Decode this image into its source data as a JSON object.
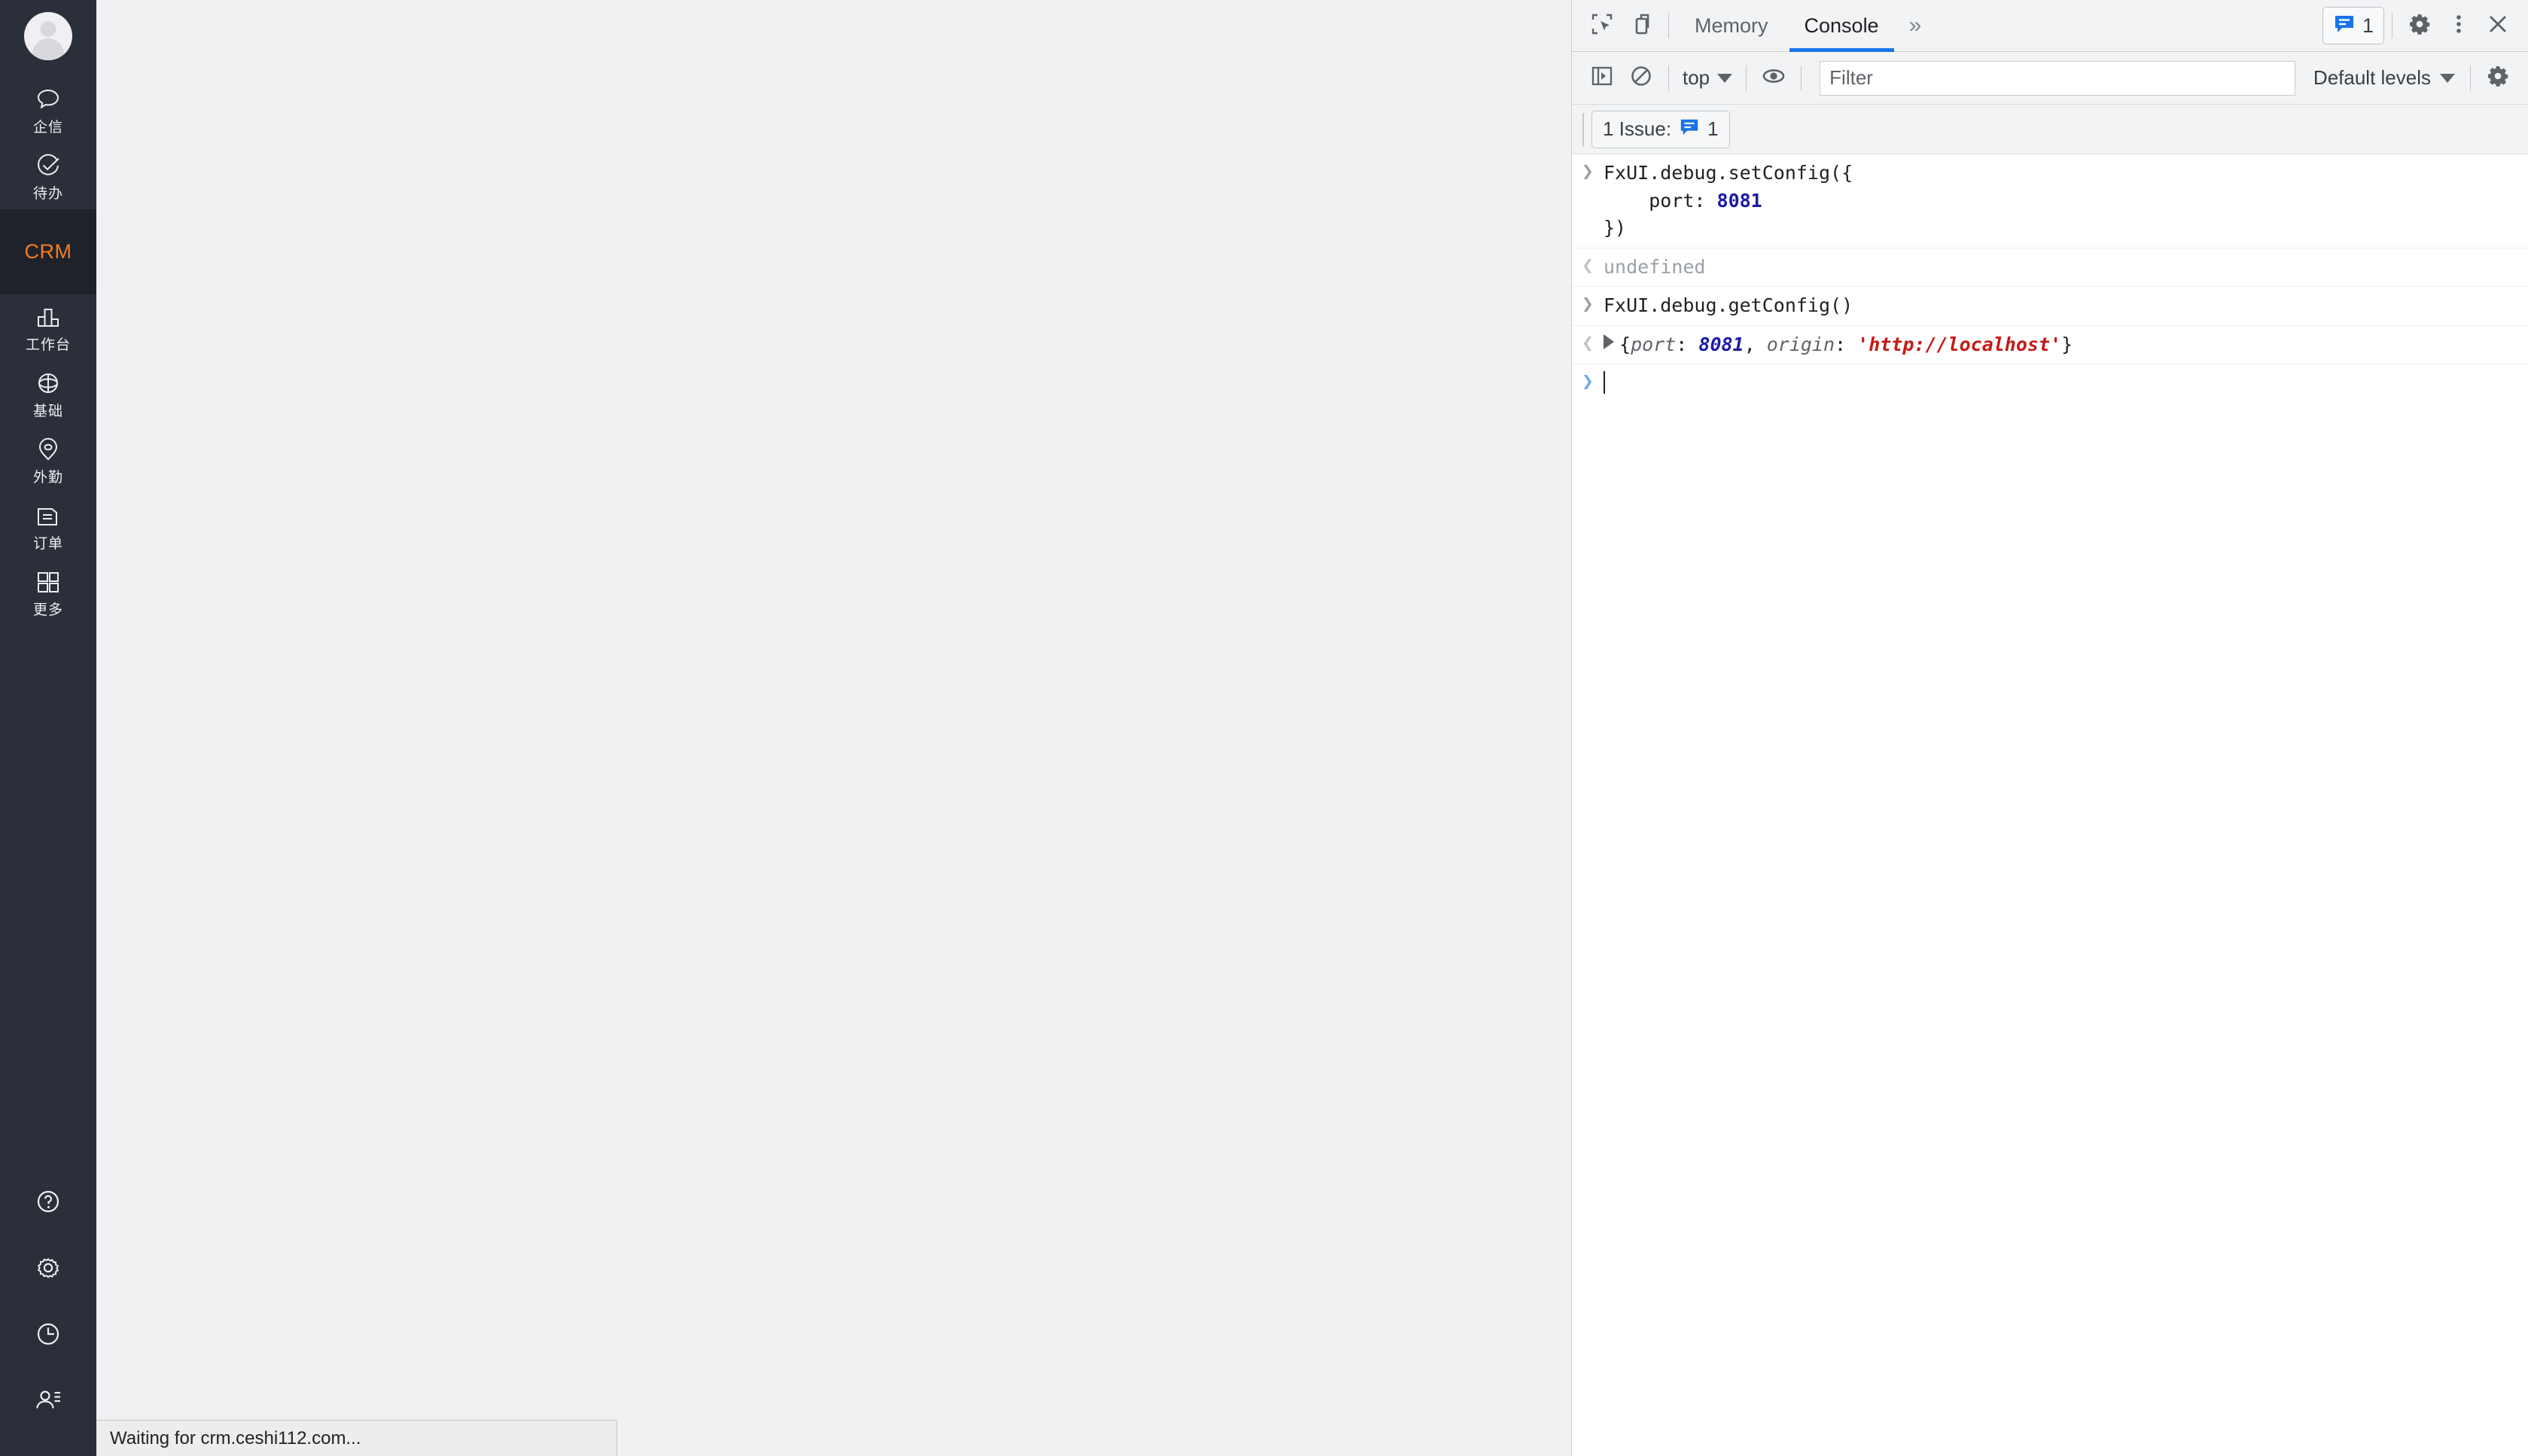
{
  "sidebar": {
    "avatar_alt": "user-avatar",
    "top_items": [
      {
        "label": "企信",
        "icon": "chat-bubble-icon"
      },
      {
        "label": "待办",
        "icon": "check-circle-icon"
      }
    ],
    "section_badge": "CRM",
    "section_badge_color": "#f57c1f",
    "main_items": [
      {
        "label": "工作台",
        "icon": "bar-chart-icon"
      },
      {
        "label": "基础",
        "icon": "globe-icon"
      },
      {
        "label": "外勤",
        "icon": "location-pin-icon"
      },
      {
        "label": "订单",
        "icon": "document-list-icon"
      },
      {
        "label": "更多",
        "icon": "grid-squares-icon"
      }
    ],
    "bottom_items": [
      {
        "icon": "help-circle-icon",
        "name": "help"
      },
      {
        "icon": "gear-icon",
        "name": "settings"
      },
      {
        "icon": "clock-icon",
        "name": "history"
      },
      {
        "icon": "user-list-icon",
        "name": "contacts"
      }
    ]
  },
  "status_bar": {
    "text": "Waiting for crm.ceshi112.com..."
  },
  "devtools": {
    "toolbar": {
      "inspect_icon": "inspect-element-icon",
      "device_icon": "device-toolbar-icon",
      "tabs": [
        {
          "label": "Memory",
          "active": false
        },
        {
          "label": "Console",
          "active": true
        }
      ],
      "more_tabs_glyph": "»",
      "issues_count": "1",
      "issues_icon": "issue-message-icon",
      "settings_icon": "gear-icon",
      "kebab_icon": "more-vertical-icon",
      "close_icon": "close-icon"
    },
    "filterbar": {
      "sidebar_toggle_icon": "console-sidebar-icon",
      "clear_icon": "clear-console-icon",
      "context": "top",
      "live_expression_icon": "eye-icon",
      "filter_placeholder": "Filter",
      "filter_value": "",
      "levels": "Default levels",
      "settings_icon": "gear-icon"
    },
    "issues_bar": {
      "label": "1 Issue:",
      "count": "1",
      "icon": "issue-message-icon"
    },
    "console": {
      "entries": [
        {
          "kind": "input",
          "marker": ">",
          "lines": [
            [
              {
                "t": "FxUI.debug.setConfig({",
                "c": "plain"
              }
            ],
            [
              {
                "t": "    port: ",
                "c": "plain"
              },
              {
                "t": "8081",
                "c": "num"
              }
            ],
            [
              {
                "t": "})",
                "c": "plain"
              }
            ]
          ]
        },
        {
          "kind": "output",
          "marker": "<",
          "lines": [
            [
              {
                "t": "undefined",
                "c": "undef"
              }
            ]
          ]
        },
        {
          "kind": "input",
          "marker": ">",
          "lines": [
            [
              {
                "t": "FxUI.debug.getConfig()",
                "c": "plain"
              }
            ]
          ]
        },
        {
          "kind": "output",
          "marker": "<",
          "expandable": true,
          "lines": [
            [
              {
                "t": "{",
                "c": "brace"
              },
              {
                "t": "port",
                "c": "key"
              },
              {
                "t": ": ",
                "c": "brace"
              },
              {
                "t": "8081",
                "c": "numi"
              },
              {
                "t": ", ",
                "c": "brace"
              },
              {
                "t": "origin",
                "c": "key"
              },
              {
                "t": ": ",
                "c": "brace"
              },
              {
                "t": "'http://localhost'",
                "c": "str"
              },
              {
                "t": "}",
                "c": "brace"
              }
            ]
          ]
        },
        {
          "kind": "prompt",
          "marker": ">",
          "lines": [
            []
          ]
        }
      ]
    }
  },
  "colors": {
    "sidebar_bg": "#2b2f3a",
    "sidebar_section_bg": "#1f222b",
    "accent_orange": "#f57c1f",
    "content_bg": "#f1f1f3",
    "devtools_chrome": "#f1f3f4",
    "tab_active_underline": "#1a73e8",
    "issue_blue": "#1a73e8",
    "console_string_red": "#c41a16",
    "console_number_blue": "#1a1aa6"
  }
}
